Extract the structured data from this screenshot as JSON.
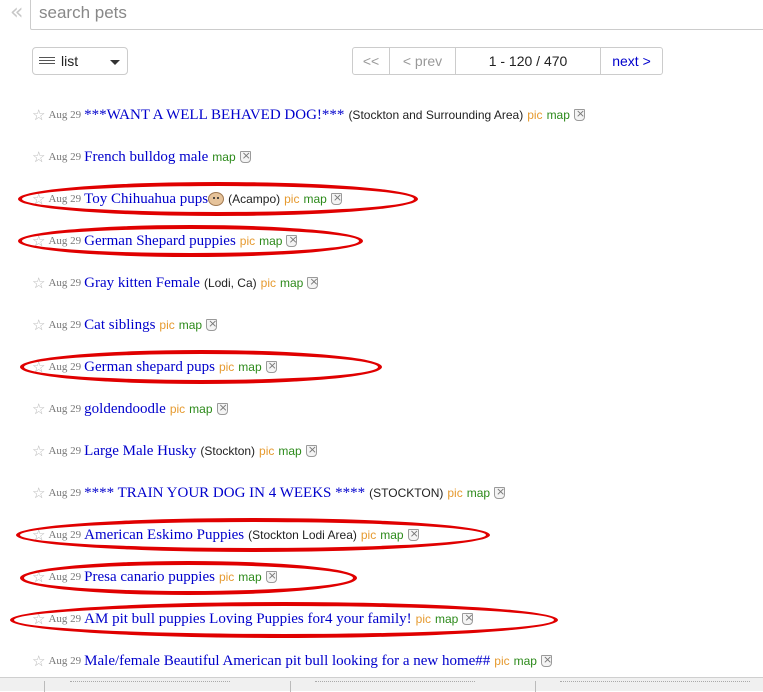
{
  "search": {
    "placeholder": "search pets"
  },
  "view_select": {
    "label": "list"
  },
  "pager": {
    "first": "<<",
    "prev": "< prev",
    "range": "1 - 120 / 470",
    "next": "next >"
  },
  "colors": {
    "link": "#0000cc",
    "pic": "#e69a2f",
    "map": "#2c8a1a",
    "annotation": "#e00000"
  },
  "listings": [
    {
      "date": "Aug 29",
      "title": "***WANT A WELL BEHAVED DOG!***",
      "hood": "(Stockton and Surrounding Area)",
      "pic": "pic",
      "map": "map",
      "circled": false
    },
    {
      "date": "Aug 29",
      "title": "French bulldog male",
      "hood": "",
      "pic": "",
      "map": "map",
      "circled": false
    },
    {
      "date": "Aug 29",
      "title": "Toy Chihuahua pups",
      "emoji": "dog-face-icon",
      "hood": "(Acampo)",
      "pic": "pic",
      "map": "map",
      "circled": true
    },
    {
      "date": "Aug 29",
      "title": "German Shepard puppies",
      "hood": "",
      "pic": "pic",
      "map": "map",
      "circled": true
    },
    {
      "date": "Aug 29",
      "title": "Gray kitten Female",
      "hood": "(Lodi, Ca)",
      "pic": "pic",
      "map": "map",
      "circled": false
    },
    {
      "date": "Aug 29",
      "title": "Cat siblings",
      "hood": "",
      "pic": "pic",
      "map": "map",
      "circled": false
    },
    {
      "date": "Aug 29",
      "title": "German shepard pups",
      "hood": "",
      "pic": "pic",
      "map": "map",
      "circled": true
    },
    {
      "date": "Aug 29",
      "title": "goldendoodle",
      "hood": "",
      "pic": "pic",
      "map": "map",
      "circled": false
    },
    {
      "date": "Aug 29",
      "title": "Large Male Husky",
      "hood": "(Stockton)",
      "pic": "pic",
      "map": "map",
      "circled": false
    },
    {
      "date": "Aug 29",
      "title": "**** TRAIN YOUR DOG IN 4 WEEKS ****",
      "hood": "(STOCKTON)",
      "pic": "pic",
      "map": "map",
      "circled": false
    },
    {
      "date": "Aug 29",
      "title": "American Eskimo Puppies",
      "hood": "(Stockton Lodi Area)",
      "pic": "pic",
      "map": "map",
      "circled": true
    },
    {
      "date": "Aug 29",
      "title": "Presa canario puppies",
      "hood": "",
      "pic": "pic",
      "map": "map",
      "circled": true
    },
    {
      "date": "Aug 29",
      "title": "AM pit bull puppies Loving Puppies for4 your family!",
      "hood": "",
      "pic": "pic",
      "map": "map",
      "circled": true
    },
    {
      "date": "Aug 29",
      "title": "Male/female Beautiful American pit bull looking for a new home##",
      "hood": "",
      "pic": "pic",
      "map": "map",
      "circled": false
    }
  ]
}
